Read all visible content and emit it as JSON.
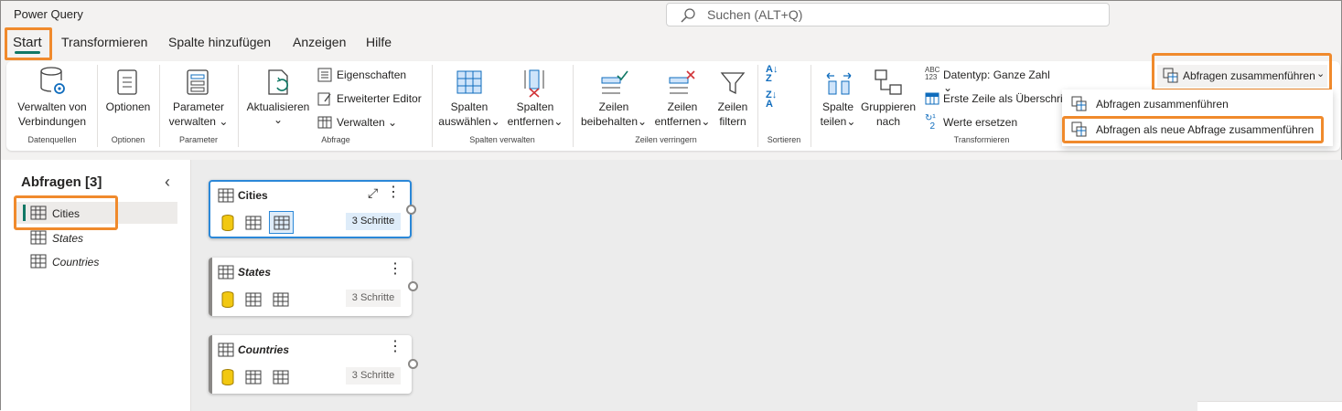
{
  "app_title": "Power Query",
  "search": {
    "placeholder": "Suchen (ALT+Q)"
  },
  "tabs": [
    "Start",
    "Transformieren",
    "Spalte hinzufügen",
    "Anzeigen",
    "Hilfe"
  ],
  "ribbon": {
    "datenquellen": {
      "button": "Verwalten von Verbindungen",
      "group": "Datenquellen"
    },
    "optionen": {
      "button": "Optionen",
      "group": "Optionen"
    },
    "parameter": {
      "button_l1": "Parameter",
      "button_l2": "verwalten",
      "group": "Parameter"
    },
    "abfrage": {
      "refresh_l1": "Aktualisieren",
      "eigenschaften": "Eigenschaften",
      "editor": "Erweiterter Editor",
      "verwalten": "Verwalten",
      "group": "Abfrage"
    },
    "spalten": {
      "select_l1": "Spalten",
      "select_l2": "auswählen",
      "remove_l1": "Spalten",
      "remove_l2": "entfernen",
      "group": "Spalten verwalten"
    },
    "zeilen": {
      "keep_l1": "Zeilen",
      "keep_l2": "beibehalten",
      "remove_l1": "Zeilen",
      "remove_l2": "entfernen",
      "filter_l1": "Zeilen",
      "filter_l2": "filtern",
      "group": "Zeilen verringern"
    },
    "sortieren": {
      "group": "Sortieren"
    },
    "transformieren": {
      "split_l1": "Spalte",
      "split_l2": "teilen",
      "group_l1": "Gruppieren",
      "group_l2": "nach",
      "datatype": "Datentyp: Ganze Zahl",
      "header": "Erste Zeile als Überschrif",
      "replace": "Werte ersetzen",
      "group": "Transformieren"
    },
    "combine": {
      "button": "Abfragen zusammenführen"
    }
  },
  "dropdown": {
    "item1": "Abfragen zusammenführen",
    "item2": "Abfragen als neue Abfrage zusammenführen"
  },
  "sidebar": {
    "title": "Abfragen [3]",
    "items": [
      "Cities",
      "States",
      "Countries"
    ]
  },
  "cards": [
    {
      "name": "Cities",
      "steps": "3 Schritte"
    },
    {
      "name": "States",
      "steps": "3 Schritte"
    },
    {
      "name": "Countries",
      "steps": "3 Schritte"
    }
  ],
  "colors": {
    "accent": "#117865",
    "highlight": "#f08a2c",
    "selection": "#2b88d8"
  }
}
